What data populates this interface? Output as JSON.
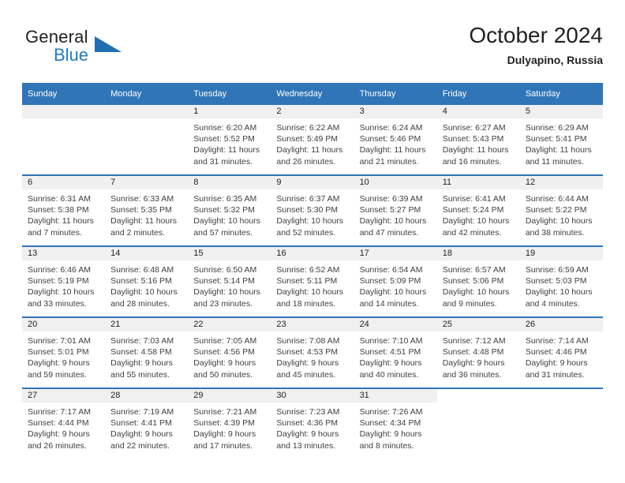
{
  "brand": {
    "name_top": "General",
    "name_bottom": "Blue",
    "color_blue": "#1f7bc1",
    "color_dark": "#231f20",
    "triangle_icon": "triangle-icon"
  },
  "header": {
    "title": "October 2024",
    "location": "Dulyapino, Russia"
  },
  "theme": {
    "header_blue": "#3075b8",
    "band_gray": "#f0f0f0",
    "text_dark": "#231f20",
    "text_body": "#3f3f3f"
  },
  "weekday_headers": [
    "Sunday",
    "Monday",
    "Tuesday",
    "Wednesday",
    "Thursday",
    "Friday",
    "Saturday"
  ],
  "weeks": [
    [
      {
        "day": "",
        "lines": []
      },
      {
        "day": "",
        "lines": []
      },
      {
        "day": "1",
        "lines": [
          "Sunrise: 6:20 AM",
          "Sunset: 5:52 PM",
          "Daylight: 11 hours",
          "and 31 minutes."
        ]
      },
      {
        "day": "2",
        "lines": [
          "Sunrise: 6:22 AM",
          "Sunset: 5:49 PM",
          "Daylight: 11 hours",
          "and 26 minutes."
        ]
      },
      {
        "day": "3",
        "lines": [
          "Sunrise: 6:24 AM",
          "Sunset: 5:46 PM",
          "Daylight: 11 hours",
          "and 21 minutes."
        ]
      },
      {
        "day": "4",
        "lines": [
          "Sunrise: 6:27 AM",
          "Sunset: 5:43 PM",
          "Daylight: 11 hours",
          "and 16 minutes."
        ]
      },
      {
        "day": "5",
        "lines": [
          "Sunrise: 6:29 AM",
          "Sunset: 5:41 PM",
          "Daylight: 11 hours",
          "and 11 minutes."
        ]
      }
    ],
    [
      {
        "day": "6",
        "lines": [
          "Sunrise: 6:31 AM",
          "Sunset: 5:38 PM",
          "Daylight: 11 hours",
          "and 7 minutes."
        ]
      },
      {
        "day": "7",
        "lines": [
          "Sunrise: 6:33 AM",
          "Sunset: 5:35 PM",
          "Daylight: 11 hours",
          "and 2 minutes."
        ]
      },
      {
        "day": "8",
        "lines": [
          "Sunrise: 6:35 AM",
          "Sunset: 5:32 PM",
          "Daylight: 10 hours",
          "and 57 minutes."
        ]
      },
      {
        "day": "9",
        "lines": [
          "Sunrise: 6:37 AM",
          "Sunset: 5:30 PM",
          "Daylight: 10 hours",
          "and 52 minutes."
        ]
      },
      {
        "day": "10",
        "lines": [
          "Sunrise: 6:39 AM",
          "Sunset: 5:27 PM",
          "Daylight: 10 hours",
          "and 47 minutes."
        ]
      },
      {
        "day": "11",
        "lines": [
          "Sunrise: 6:41 AM",
          "Sunset: 5:24 PM",
          "Daylight: 10 hours",
          "and 42 minutes."
        ]
      },
      {
        "day": "12",
        "lines": [
          "Sunrise: 6:44 AM",
          "Sunset: 5:22 PM",
          "Daylight: 10 hours",
          "and 38 minutes."
        ]
      }
    ],
    [
      {
        "day": "13",
        "lines": [
          "Sunrise: 6:46 AM",
          "Sunset: 5:19 PM",
          "Daylight: 10 hours",
          "and 33 minutes."
        ]
      },
      {
        "day": "14",
        "lines": [
          "Sunrise: 6:48 AM",
          "Sunset: 5:16 PM",
          "Daylight: 10 hours",
          "and 28 minutes."
        ]
      },
      {
        "day": "15",
        "lines": [
          "Sunrise: 6:50 AM",
          "Sunset: 5:14 PM",
          "Daylight: 10 hours",
          "and 23 minutes."
        ]
      },
      {
        "day": "16",
        "lines": [
          "Sunrise: 6:52 AM",
          "Sunset: 5:11 PM",
          "Daylight: 10 hours",
          "and 18 minutes."
        ]
      },
      {
        "day": "17",
        "lines": [
          "Sunrise: 6:54 AM",
          "Sunset: 5:09 PM",
          "Daylight: 10 hours",
          "and 14 minutes."
        ]
      },
      {
        "day": "18",
        "lines": [
          "Sunrise: 6:57 AM",
          "Sunset: 5:06 PM",
          "Daylight: 10 hours",
          "and 9 minutes."
        ]
      },
      {
        "day": "19",
        "lines": [
          "Sunrise: 6:59 AM",
          "Sunset: 5:03 PM",
          "Daylight: 10 hours",
          "and 4 minutes."
        ]
      }
    ],
    [
      {
        "day": "20",
        "lines": [
          "Sunrise: 7:01 AM",
          "Sunset: 5:01 PM",
          "Daylight: 9 hours",
          "and 59 minutes."
        ]
      },
      {
        "day": "21",
        "lines": [
          "Sunrise: 7:03 AM",
          "Sunset: 4:58 PM",
          "Daylight: 9 hours",
          "and 55 minutes."
        ]
      },
      {
        "day": "22",
        "lines": [
          "Sunrise: 7:05 AM",
          "Sunset: 4:56 PM",
          "Daylight: 9 hours",
          "and 50 minutes."
        ]
      },
      {
        "day": "23",
        "lines": [
          "Sunrise: 7:08 AM",
          "Sunset: 4:53 PM",
          "Daylight: 9 hours",
          "and 45 minutes."
        ]
      },
      {
        "day": "24",
        "lines": [
          "Sunrise: 7:10 AM",
          "Sunset: 4:51 PM",
          "Daylight: 9 hours",
          "and 40 minutes."
        ]
      },
      {
        "day": "25",
        "lines": [
          "Sunrise: 7:12 AM",
          "Sunset: 4:48 PM",
          "Daylight: 9 hours",
          "and 36 minutes."
        ]
      },
      {
        "day": "26",
        "lines": [
          "Sunrise: 7:14 AM",
          "Sunset: 4:46 PM",
          "Daylight: 9 hours",
          "and 31 minutes."
        ]
      }
    ],
    [
      {
        "day": "27",
        "lines": [
          "Sunrise: 7:17 AM",
          "Sunset: 4:44 PM",
          "Daylight: 9 hours",
          "and 26 minutes."
        ]
      },
      {
        "day": "28",
        "lines": [
          "Sunrise: 7:19 AM",
          "Sunset: 4:41 PM",
          "Daylight: 9 hours",
          "and 22 minutes."
        ]
      },
      {
        "day": "29",
        "lines": [
          "Sunrise: 7:21 AM",
          "Sunset: 4:39 PM",
          "Daylight: 9 hours",
          "and 17 minutes."
        ]
      },
      {
        "day": "30",
        "lines": [
          "Sunrise: 7:23 AM",
          "Sunset: 4:36 PM",
          "Daylight: 9 hours",
          "and 13 minutes."
        ]
      },
      {
        "day": "31",
        "lines": [
          "Sunrise: 7:26 AM",
          "Sunset: 4:34 PM",
          "Daylight: 9 hours",
          "and 8 minutes."
        ]
      },
      {
        "day": "",
        "lines": []
      },
      {
        "day": "",
        "lines": []
      }
    ]
  ]
}
